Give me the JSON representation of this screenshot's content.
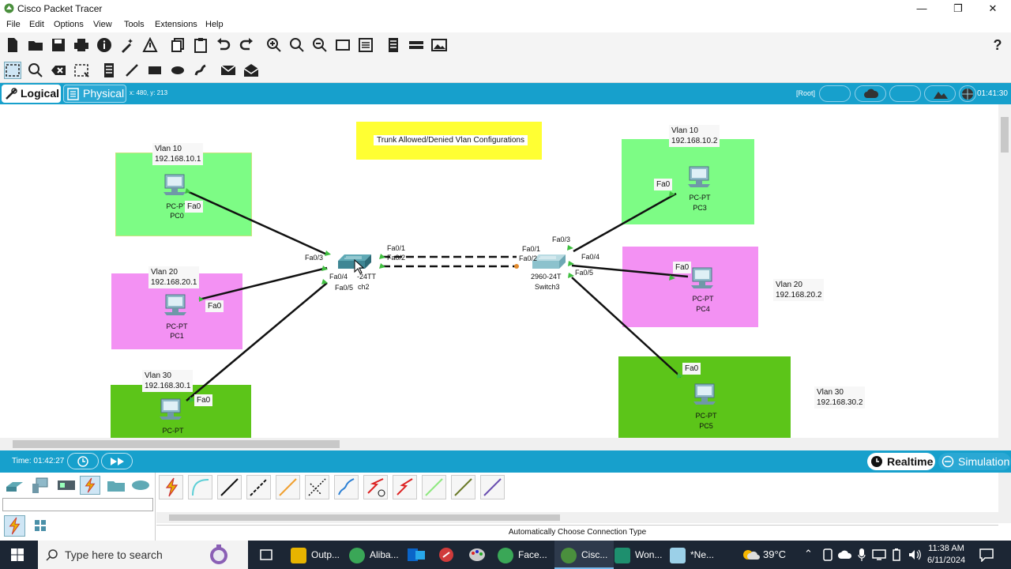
{
  "window": {
    "title": "Cisco Packet Tracer",
    "controls": [
      "—",
      "❐",
      "✕"
    ]
  },
  "menu": [
    "File",
    "Edit",
    "Options",
    "View",
    "Tools",
    "Extensions",
    "Help"
  ],
  "modebar": {
    "logical": "Logical",
    "physical": "Physical",
    "coords": "x: 480, y: 213",
    "root": "[Root]",
    "clock": "01:41:30"
  },
  "note": "Trunk Allowed/Denied Vlan Configurations",
  "zones": [
    {
      "vlan": "Vlan 10",
      "ip": "192.168.10.1",
      "pc_model": "PC-PT",
      "pc_name": "PC0",
      "port": "Fa0",
      "color": "#7dfc85"
    },
    {
      "vlan": "Vlan 20",
      "ip": "192.168.20.1",
      "pc_model": "PC-PT",
      "pc_name": "PC1",
      "port": "Fa0",
      "color": "#f391f3"
    },
    {
      "vlan": "Vlan 30",
      "ip": "192.168.30.1",
      "pc_model": "PC-PT",
      "pc_name": "",
      "port": "Fa0",
      "color": "#5cc519"
    },
    {
      "vlan": "Vlan 10",
      "ip": "192.168.10.2",
      "pc_model": "PC-PT",
      "pc_name": "PC3",
      "port": "Fa0",
      "color": "#7dfc85"
    },
    {
      "vlan": "Vlan 20",
      "ip": "192.168.20.2",
      "pc_model": "PC-PT",
      "pc_name": "PC4",
      "port": "Fa0",
      "color": "#f391f3"
    },
    {
      "vlan": "Vlan 30",
      "ip": "192.168.30.2",
      "pc_model": "PC-PT",
      "pc_name": "PC5",
      "port": "Fa0",
      "color": "#5cc519"
    }
  ],
  "switch2": {
    "model": "2960-24TT",
    "model_visible": "-24TT",
    "name_visible": "ch2",
    "ports": {
      "fa03": "Fa0/3",
      "fa04": "Fa0/4",
      "fa05": "Fa0/5",
      "fa01": "Fa0/1",
      "fa02": "Fa0/2"
    }
  },
  "switch3": {
    "model": "2960-24TT",
    "model_visible": "2960-24T",
    "name": "Switch3",
    "ports": {
      "fa01": "Fa0/1",
      "fa02": "Fa0/2",
      "fa03": "Fa0/3",
      "fa04": "Fa0/4",
      "fa05": "Fa0/5"
    }
  },
  "timebar": {
    "time": "Time: 01:42:27",
    "realtime": "Realtime",
    "simulation": "Simulation"
  },
  "palette": {
    "status": "Automatically Choose Connection Type"
  },
  "taskbar": {
    "search_placeholder": "Type here to search",
    "items": [
      "Outp...",
      "Aliba...",
      "Face...",
      "Cisc...",
      "Won...",
      "*Ne..."
    ],
    "temp": "39°C",
    "time": "11:38 AM",
    "date": "6/11/2024"
  },
  "colors": {
    "accent": "#17a0cc",
    "note": "#ffff33"
  }
}
